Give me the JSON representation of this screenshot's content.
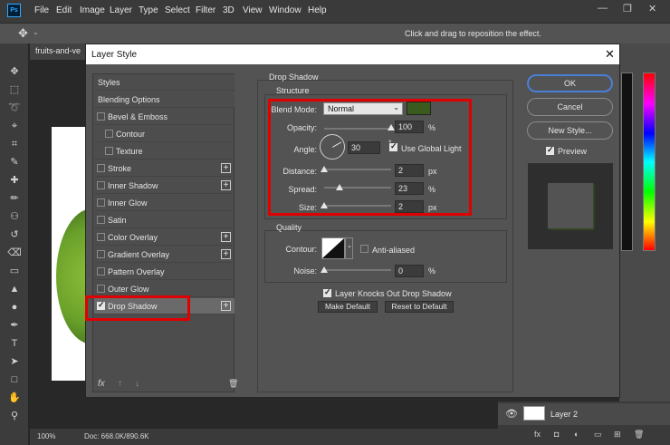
{
  "app": {
    "menu": [
      "File",
      "Edit",
      "Image",
      "Layer",
      "Type",
      "Select",
      "Filter",
      "3D",
      "View",
      "Window",
      "Help"
    ],
    "logo": "Ps",
    "window_controls": [
      "—",
      "❐",
      "✕"
    ]
  },
  "options_bar": {
    "hint": "Click and drag to reposition the effect."
  },
  "document": {
    "tab": "fruits-and-ve",
    "zoom": "100%",
    "doc_info": "Doc: 668.0K/890.6K"
  },
  "layers": {
    "layer_name": "Layer 2"
  },
  "dialog": {
    "title": "Layer Style",
    "styles_list": [
      {
        "label": "Styles",
        "header": true
      },
      {
        "label": "Blending Options",
        "header": true
      },
      {
        "label": "Bevel & Emboss",
        "checked": false,
        "plus": false
      },
      {
        "label": "Contour",
        "checked": false,
        "plus": false,
        "indent": true
      },
      {
        "label": "Texture",
        "checked": false,
        "plus": false,
        "indent": true
      },
      {
        "label": "Stroke",
        "checked": false,
        "plus": true
      },
      {
        "label": "Inner Shadow",
        "checked": false,
        "plus": true
      },
      {
        "label": "Inner Glow",
        "checked": false,
        "plus": false
      },
      {
        "label": "Satin",
        "checked": false,
        "plus": false
      },
      {
        "label": "Color Overlay",
        "checked": false,
        "plus": true
      },
      {
        "label": "Gradient Overlay",
        "checked": false,
        "plus": true
      },
      {
        "label": "Pattern Overlay",
        "checked": false,
        "plus": false
      },
      {
        "label": "Outer Glow",
        "checked": false,
        "plus": false
      },
      {
        "label": "Drop Shadow",
        "checked": true,
        "plus": true,
        "active": true
      }
    ],
    "footer_icons": [
      "fx",
      "↑",
      "↓",
      "🗑"
    ],
    "drop_shadow": {
      "section_title": "Drop Shadow",
      "structure_title": "Structure",
      "blend_mode_label": "Blend Mode:",
      "blend_mode_value": "Normal",
      "shadow_color": "#3a5a1e",
      "opacity_label": "Opacity:",
      "opacity_value": "100",
      "opacity_unit": "%",
      "opacity_level": 1.0,
      "angle_label": "Angle:",
      "angle_value": "30",
      "angle_unit": "°",
      "use_global_light_label": "Use Global Light",
      "use_global_light_checked": true,
      "distance_label": "Distance:",
      "distance_value": "2",
      "distance_unit": "px",
      "spread_label": "Spread:",
      "spread_value": "23",
      "spread_unit": "%",
      "size_label": "Size:",
      "size_value": "2",
      "size_unit": "px",
      "quality_title": "Quality",
      "contour_label": "Contour:",
      "anti_aliased_label": "Anti-aliased",
      "anti_aliased_checked": false,
      "noise_label": "Noise:",
      "noise_value": "0",
      "noise_unit": "%",
      "knocks_out_label": "Layer Knocks Out Drop Shadow",
      "knocks_out_checked": true,
      "make_default": "Make Default",
      "reset_default": "Reset to Default"
    },
    "buttons": {
      "ok": "OK",
      "cancel": "Cancel",
      "new_style": "New Style...",
      "preview_label": "Preview",
      "preview_checked": true
    }
  },
  "colors": {
    "highlight": "#e00000",
    "ok_border": "#4a7fd8",
    "panel_bg": "#535353"
  }
}
